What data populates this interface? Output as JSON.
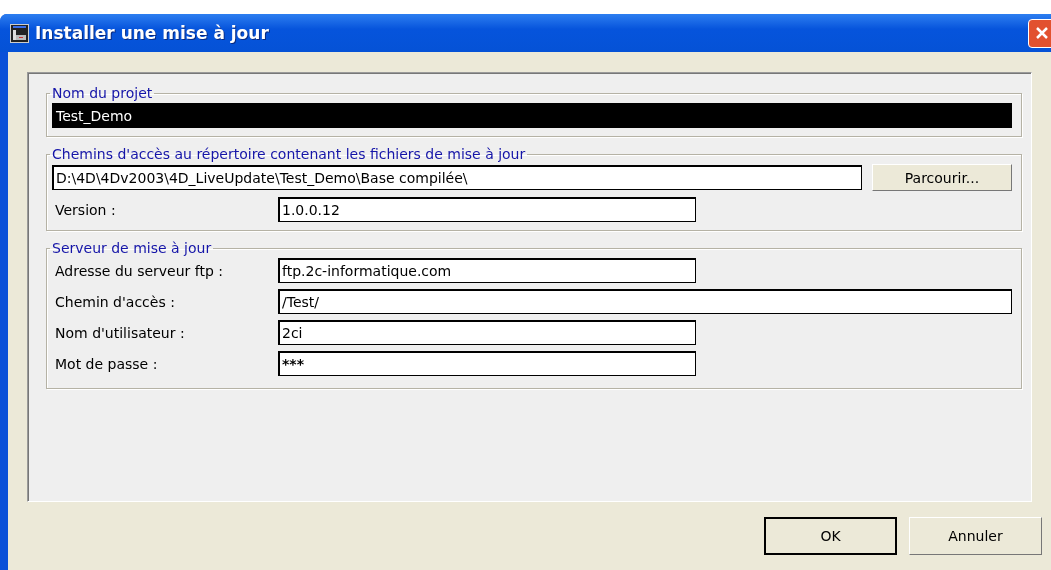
{
  "window": {
    "title": "Installer une mise à jour"
  },
  "project_group": {
    "legend": "Nom du projet",
    "field": {
      "value": "Test_Demo",
      "selected": true
    }
  },
  "paths_group": {
    "legend": "Chemins d'accès au répertoire contenant les fichiers de mise à jour",
    "path_field": {
      "value": "D:\\4D\\4Dv2003\\4D_LiveUpdate\\Test_Demo\\Base compilée\\"
    },
    "browse_button": "Parcourir...",
    "rows": [
      {
        "label": "Version :",
        "value": "1.0.0.12",
        "kind": "short"
      }
    ]
  },
  "server_group": {
    "legend": "Serveur de mise à jour",
    "rows": [
      {
        "label": "Adresse du serveur ftp :",
        "value": "ftp.2c-informatique.com",
        "kind": "short"
      },
      {
        "label": "Chemin d'accès :",
        "value": "/Test/",
        "kind": "wide"
      },
      {
        "label": "Nom d'utilisateur :",
        "value": "2ci",
        "kind": "short"
      },
      {
        "label": "Mot de passe :",
        "value": "***",
        "kind": "password"
      }
    ]
  },
  "buttons": [
    {
      "label": "OK",
      "default": true
    },
    {
      "label": "Annuler",
      "default": false
    }
  ]
}
